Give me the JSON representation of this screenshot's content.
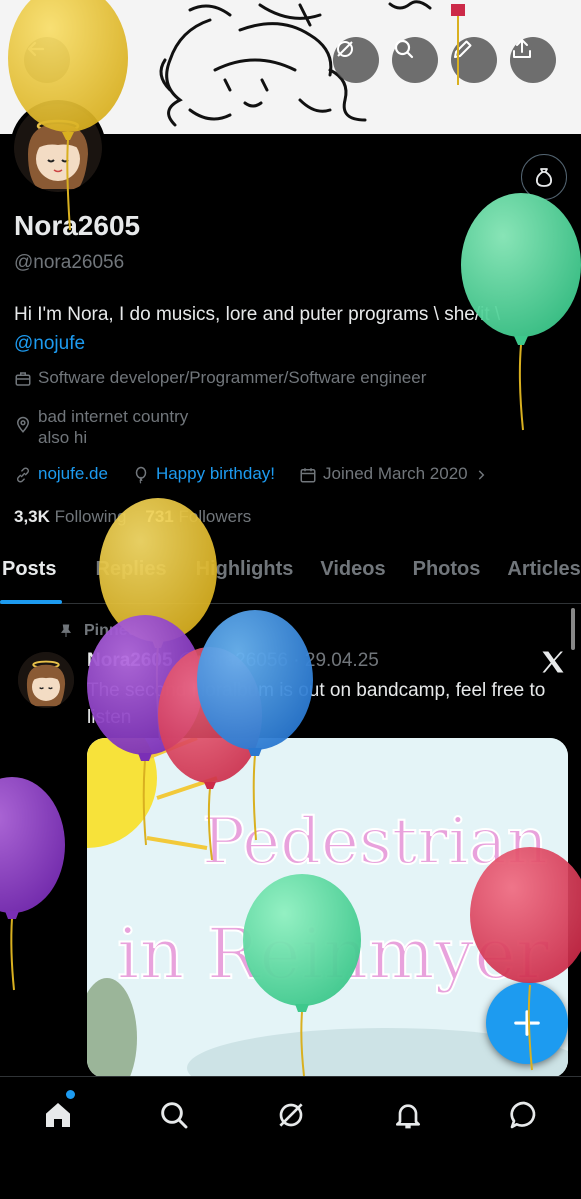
{
  "profile": {
    "display_name": "Nora2605",
    "handle": "@nora26056",
    "bio_text": "Hi I'm Nora, I do musics, lore and puter programs \\ she/it \\",
    "bio_link": "@nojufe",
    "occupation": "Software developer/Programmer/Software engineer",
    "location_line1": "bad internet country",
    "location_line2": "also hi",
    "website": "nojufe.de",
    "birthday": "Happy birthday!",
    "joined": "Joined March 2020",
    "following_count": "3,3K",
    "following_label": "Following",
    "followers_count": "731",
    "followers_label": "Followers"
  },
  "tabs": [
    {
      "label": "Posts"
    },
    {
      "label": "Replies"
    },
    {
      "label": "Highlights"
    },
    {
      "label": "Videos"
    },
    {
      "label": "Photos"
    },
    {
      "label": "Articles"
    }
  ],
  "post": {
    "pinned_label": "Pinned",
    "author": "Nora2605",
    "handle": "@nora26056",
    "separator": "·",
    "date": "29.04.25",
    "text": "The second Noralbum is out on bandcamp, feel free to listen"
  },
  "album_art": {
    "line1": "Pedestrian",
    "line2": "in Reinmyer"
  },
  "icons": {
    "back": "back-arrow-icon",
    "grok": "grok-icon",
    "search": "search-icon",
    "edit": "pencil-icon",
    "share": "share-icon",
    "moneybag": "moneybag-icon",
    "occupation": "briefcase-icon",
    "location": "location-pin-icon",
    "website": "link-icon",
    "birthday": "balloon-icon",
    "joined": "calendar-icon",
    "pin": "pin-icon",
    "x_logo": "x-logo-icon",
    "compose": "plus-icon"
  },
  "colors": {
    "accent": "#1d9bf0",
    "background": "#000000",
    "muted": "#71767b"
  }
}
